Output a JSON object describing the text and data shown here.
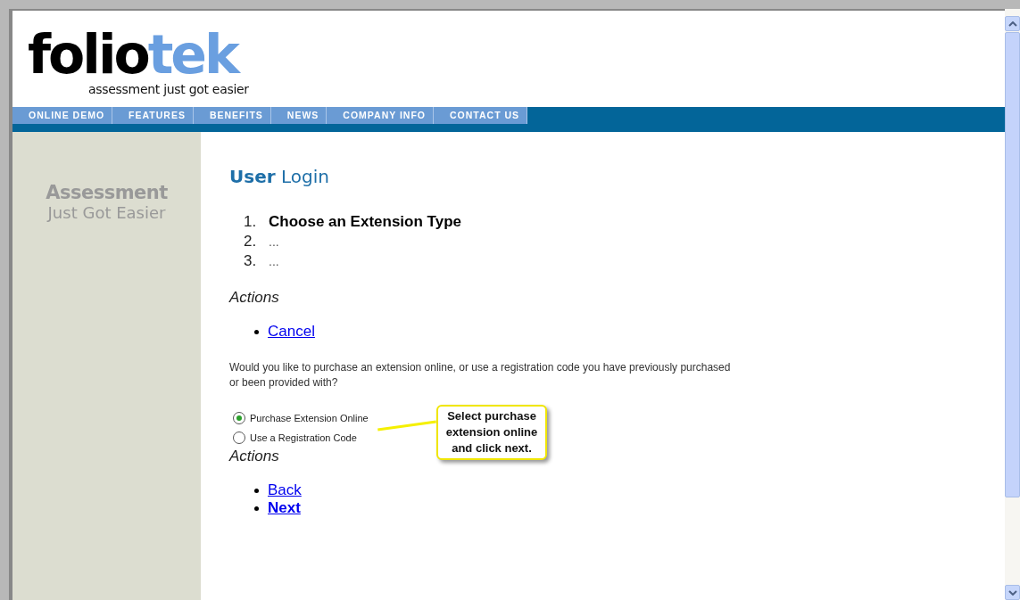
{
  "logo": {
    "main": "folio",
    "accent": "tek",
    "tagline": "assessment just got easier"
  },
  "nav": [
    {
      "label": "ONLINE DEMO"
    },
    {
      "label": "FEATURES"
    },
    {
      "label": "BENEFITS"
    },
    {
      "label": "NEWS"
    },
    {
      "label": "COMPANY INFO"
    },
    {
      "label": "CONTACT US"
    }
  ],
  "sidebar": {
    "title": "Assessment",
    "subtitle": "Just Got Easier"
  },
  "heading": "**User** Login",
  "steps": [
    {
      "number": "1.",
      "label": "Choose an Extension Type",
      "current": true
    },
    {
      "number": "2.",
      "label": "...",
      "current": false
    },
    {
      "number": "3.",
      "label": "...",
      "current": false
    }
  ],
  "actions_top": {
    "title": "Actions",
    "links": [
      {
        "label": "Cancel",
        "bold": false
      }
    ]
  },
  "question": "Would you like to purchase an extension online, or use a registration code you have previously purchased or been provided with?",
  "options": [
    {
      "label": "Purchase Extension Online",
      "selected": true
    },
    {
      "label": "Use a Registration Code",
      "selected": false
    }
  ],
  "actions_bottom": {
    "title": "Actions",
    "links": [
      {
        "label": "Back",
        "bold": false
      },
      {
        "label": "Next",
        "bold": true
      }
    ]
  },
  "callout": "Select purchase extension online and click next."
}
